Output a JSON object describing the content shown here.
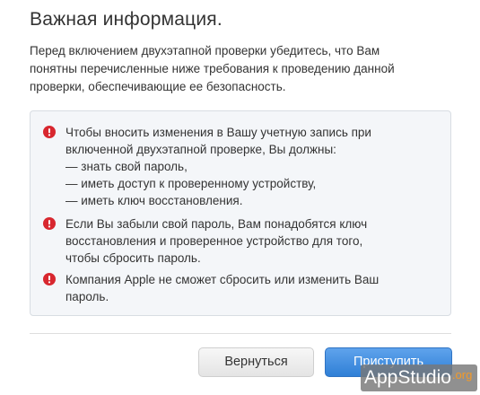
{
  "header": {
    "title": "Важная информация."
  },
  "intro": {
    "lines": [
      "Перед включением двухэтапной проверки убедитесь, что Вам",
      "понятны перечисленные ниже требования к проведению данной",
      "проверки, обеспечивающие ее безопасность."
    ]
  },
  "info": {
    "icon": "alert-icon",
    "icon_color": "#d8272f",
    "box_background": "#f4f6f9",
    "items": [
      {
        "lines": [
          "Чтобы вносить изменения в Вашу учетную запись при",
          "включенной двухэтапной проверке, Вы должны:",
          "— знать свой пароль,",
          "— иметь доступ к проверенному устройству,",
          "— иметь ключ восстановления."
        ]
      },
      {
        "lines": [
          "Если Вы забыли свой пароль, Вам понадобятся ключ",
          "восстановления и проверенное устройство для того,",
          "чтобы сбросить пароль."
        ]
      },
      {
        "lines": [
          "Компания Apple не сможет сбросить или изменить Ваш",
          "пароль."
        ]
      }
    ]
  },
  "buttons": {
    "back_label": "Вернуться",
    "next_label": "Приступить",
    "next_color": "#3d8be0"
  },
  "watermark": {
    "main": "AppStudio",
    "tld": ".org"
  }
}
